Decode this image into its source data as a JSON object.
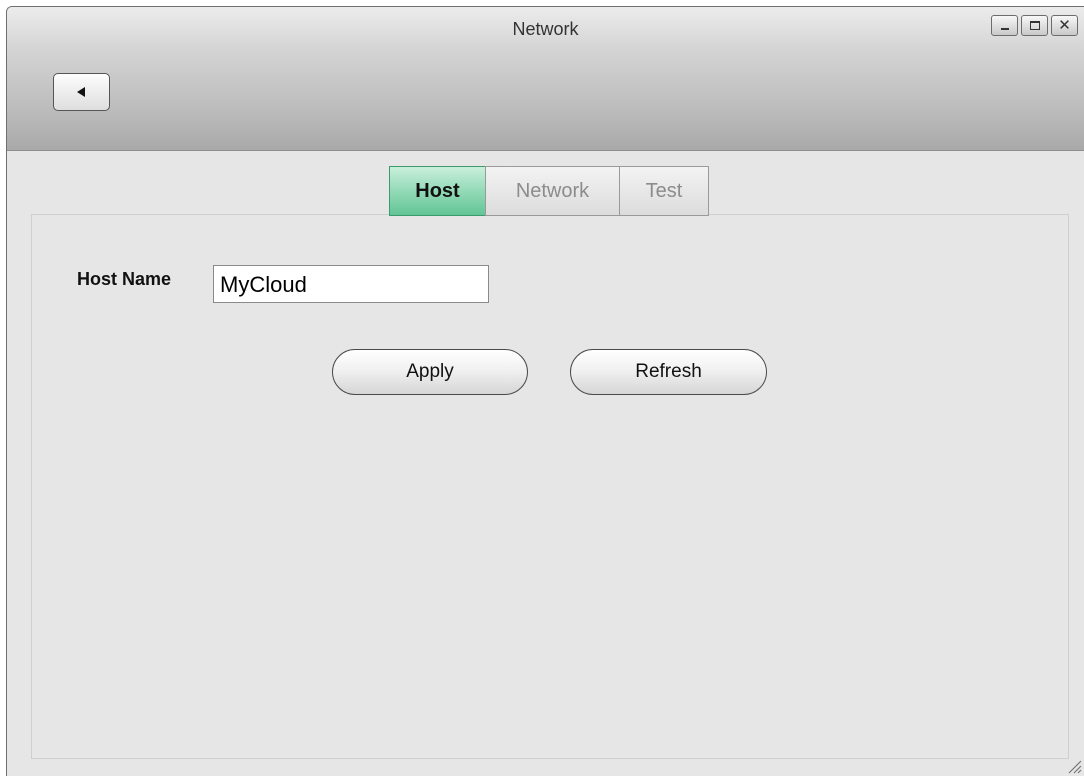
{
  "window": {
    "title": "Network",
    "controls": {
      "minimize_icon": "minimize-icon",
      "maximize_icon": "maximize-icon",
      "close_icon": "close-icon",
      "close_glyph": "✕"
    }
  },
  "toolbar": {
    "back_icon": "back-arrow-icon"
  },
  "tabs": [
    {
      "label": "Host",
      "active": true
    },
    {
      "label": "Network",
      "active": false
    },
    {
      "label": "Test",
      "active": false
    }
  ],
  "form": {
    "host_name_label": "Host Name",
    "host_name_value": "MyCloud"
  },
  "buttons": {
    "apply_label": "Apply",
    "refresh_label": "Refresh"
  },
  "colors": {
    "active_tab": "#8ed8b4",
    "active_tab_border": "#3d9a6d",
    "panel_background": "#e6e6e6"
  }
}
